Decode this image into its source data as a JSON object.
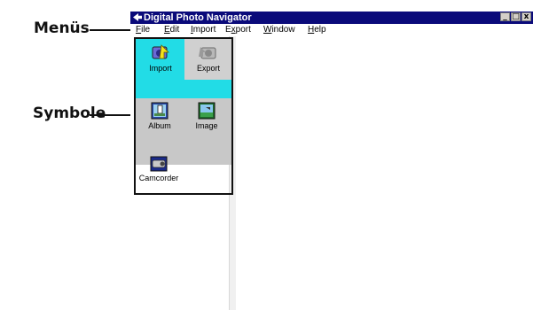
{
  "callouts": {
    "menus": "Menüs",
    "symbols": "Symbole"
  },
  "window": {
    "title": "Digital Photo Navigator",
    "controls": [
      "_",
      "□",
      "x"
    ]
  },
  "menubar": {
    "items": [
      {
        "label": "File",
        "mnemonic": "F"
      },
      {
        "label": "Edit",
        "mnemonic": "E"
      },
      {
        "label": "Import",
        "mnemonic": "I"
      },
      {
        "label": "Export",
        "mnemonic": "x"
      },
      {
        "label": "Window",
        "mnemonic": "W"
      },
      {
        "label": "Help",
        "mnemonic": "H"
      }
    ]
  },
  "symbols": {
    "import": "Import",
    "export": "Export",
    "album": "Album",
    "image": "Image",
    "camcorder": "Camcorder"
  },
  "colors": {
    "titlebar": "#0a0a7a",
    "import_tab": "#22dce6",
    "panel_gray": "#c8c8c8"
  }
}
